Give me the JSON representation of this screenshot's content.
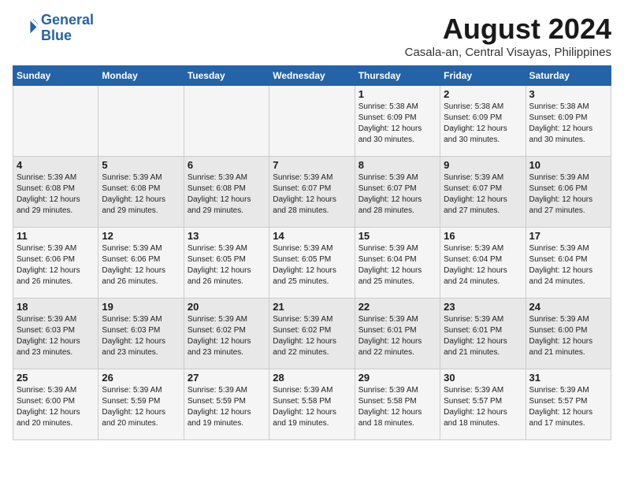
{
  "header": {
    "logo_line1": "General",
    "logo_line2": "Blue",
    "month_year": "August 2024",
    "location": "Casala-an, Central Visayas, Philippines"
  },
  "columns": [
    "Sunday",
    "Monday",
    "Tuesday",
    "Wednesday",
    "Thursday",
    "Friday",
    "Saturday"
  ],
  "weeks": [
    [
      {
        "day": "",
        "info": ""
      },
      {
        "day": "",
        "info": ""
      },
      {
        "day": "",
        "info": ""
      },
      {
        "day": "",
        "info": ""
      },
      {
        "day": "1",
        "info": "Sunrise: 5:38 AM\nSunset: 6:09 PM\nDaylight: 12 hours\nand 30 minutes."
      },
      {
        "day": "2",
        "info": "Sunrise: 5:38 AM\nSunset: 6:09 PM\nDaylight: 12 hours\nand 30 minutes."
      },
      {
        "day": "3",
        "info": "Sunrise: 5:38 AM\nSunset: 6:09 PM\nDaylight: 12 hours\nand 30 minutes."
      }
    ],
    [
      {
        "day": "4",
        "info": "Sunrise: 5:39 AM\nSunset: 6:08 PM\nDaylight: 12 hours\nand 29 minutes."
      },
      {
        "day": "5",
        "info": "Sunrise: 5:39 AM\nSunset: 6:08 PM\nDaylight: 12 hours\nand 29 minutes."
      },
      {
        "day": "6",
        "info": "Sunrise: 5:39 AM\nSunset: 6:08 PM\nDaylight: 12 hours\nand 29 minutes."
      },
      {
        "day": "7",
        "info": "Sunrise: 5:39 AM\nSunset: 6:07 PM\nDaylight: 12 hours\nand 28 minutes."
      },
      {
        "day": "8",
        "info": "Sunrise: 5:39 AM\nSunset: 6:07 PM\nDaylight: 12 hours\nand 28 minutes."
      },
      {
        "day": "9",
        "info": "Sunrise: 5:39 AM\nSunset: 6:07 PM\nDaylight: 12 hours\nand 27 minutes."
      },
      {
        "day": "10",
        "info": "Sunrise: 5:39 AM\nSunset: 6:06 PM\nDaylight: 12 hours\nand 27 minutes."
      }
    ],
    [
      {
        "day": "11",
        "info": "Sunrise: 5:39 AM\nSunset: 6:06 PM\nDaylight: 12 hours\nand 26 minutes."
      },
      {
        "day": "12",
        "info": "Sunrise: 5:39 AM\nSunset: 6:06 PM\nDaylight: 12 hours\nand 26 minutes."
      },
      {
        "day": "13",
        "info": "Sunrise: 5:39 AM\nSunset: 6:05 PM\nDaylight: 12 hours\nand 26 minutes."
      },
      {
        "day": "14",
        "info": "Sunrise: 5:39 AM\nSunset: 6:05 PM\nDaylight: 12 hours\nand 25 minutes."
      },
      {
        "day": "15",
        "info": "Sunrise: 5:39 AM\nSunset: 6:04 PM\nDaylight: 12 hours\nand 25 minutes."
      },
      {
        "day": "16",
        "info": "Sunrise: 5:39 AM\nSunset: 6:04 PM\nDaylight: 12 hours\nand 24 minutes."
      },
      {
        "day": "17",
        "info": "Sunrise: 5:39 AM\nSunset: 6:04 PM\nDaylight: 12 hours\nand 24 minutes."
      }
    ],
    [
      {
        "day": "18",
        "info": "Sunrise: 5:39 AM\nSunset: 6:03 PM\nDaylight: 12 hours\nand 23 minutes."
      },
      {
        "day": "19",
        "info": "Sunrise: 5:39 AM\nSunset: 6:03 PM\nDaylight: 12 hours\nand 23 minutes."
      },
      {
        "day": "20",
        "info": "Sunrise: 5:39 AM\nSunset: 6:02 PM\nDaylight: 12 hours\nand 23 minutes."
      },
      {
        "day": "21",
        "info": "Sunrise: 5:39 AM\nSunset: 6:02 PM\nDaylight: 12 hours\nand 22 minutes."
      },
      {
        "day": "22",
        "info": "Sunrise: 5:39 AM\nSunset: 6:01 PM\nDaylight: 12 hours\nand 22 minutes."
      },
      {
        "day": "23",
        "info": "Sunrise: 5:39 AM\nSunset: 6:01 PM\nDaylight: 12 hours\nand 21 minutes."
      },
      {
        "day": "24",
        "info": "Sunrise: 5:39 AM\nSunset: 6:00 PM\nDaylight: 12 hours\nand 21 minutes."
      }
    ],
    [
      {
        "day": "25",
        "info": "Sunrise: 5:39 AM\nSunset: 6:00 PM\nDaylight: 12 hours\nand 20 minutes."
      },
      {
        "day": "26",
        "info": "Sunrise: 5:39 AM\nSunset: 5:59 PM\nDaylight: 12 hours\nand 20 minutes."
      },
      {
        "day": "27",
        "info": "Sunrise: 5:39 AM\nSunset: 5:59 PM\nDaylight: 12 hours\nand 19 minutes."
      },
      {
        "day": "28",
        "info": "Sunrise: 5:39 AM\nSunset: 5:58 PM\nDaylight: 12 hours\nand 19 minutes."
      },
      {
        "day": "29",
        "info": "Sunrise: 5:39 AM\nSunset: 5:58 PM\nDaylight: 12 hours\nand 18 minutes."
      },
      {
        "day": "30",
        "info": "Sunrise: 5:39 AM\nSunset: 5:57 PM\nDaylight: 12 hours\nand 18 minutes."
      },
      {
        "day": "31",
        "info": "Sunrise: 5:39 AM\nSunset: 5:57 PM\nDaylight: 12 hours\nand 17 minutes."
      }
    ]
  ]
}
